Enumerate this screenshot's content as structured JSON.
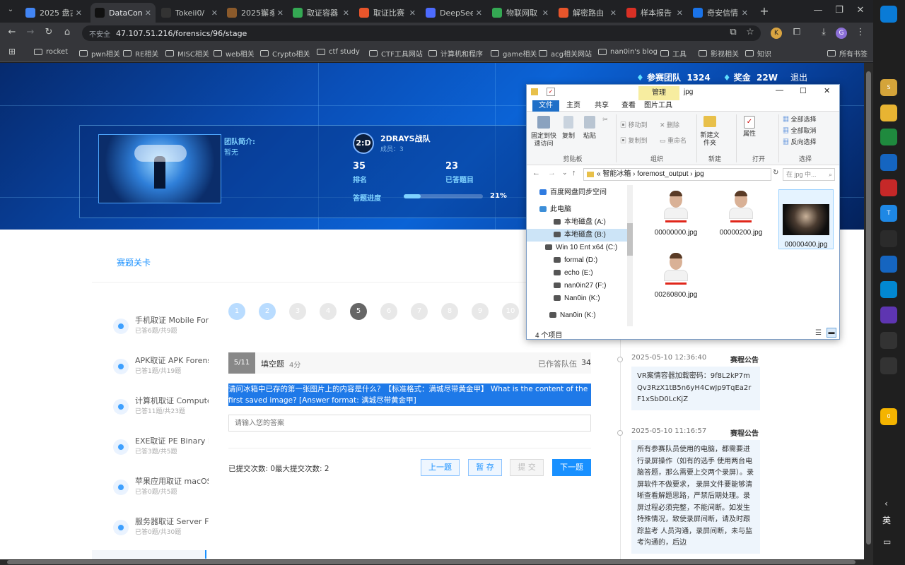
{
  "browser": {
    "tabs": [
      {
        "label": "2025 盘古",
        "color": "#4285f4",
        "active": false
      },
      {
        "label": "DataCon",
        "color": "#111111",
        "active": true
      },
      {
        "label": "Tokeii0/",
        "color": "#333333",
        "active": false
      },
      {
        "label": "2025獬豸",
        "color": "#8b5a2b",
        "active": false
      },
      {
        "label": "取证容器",
        "color": "#34a853",
        "active": false
      },
      {
        "label": "取证比赛",
        "color": "#e8552b",
        "active": false
      },
      {
        "label": "DeepSeek",
        "color": "#4d6bfe",
        "active": false
      },
      {
        "label": "物联网取",
        "color": "#34a853",
        "active": false
      },
      {
        "label": "解密路由",
        "color": "#e8552b",
        "active": false
      },
      {
        "label": "样本报告",
        "color": "#d93025",
        "active": false
      },
      {
        "label": "奇安信情",
        "color": "#1a73e8",
        "active": false
      }
    ],
    "new_tab": "+",
    "url_insecure": "不安全",
    "url": "47.107.51.216/forensics/96/stage",
    "avatar": "G",
    "bookmarks": [
      "rocket",
      "pwn相关",
      "RE相关",
      "MISC相关",
      "web相关",
      "Crypto相关",
      "ctf study",
      "CTF工具网站",
      "计算机和程序",
      "game相关",
      "acg相关网站",
      "nan0in's blog",
      "工具",
      "影视相关",
      "知识"
    ],
    "all_bookmarks": "所有书签"
  },
  "banner": {
    "teams_label": "参赛团队",
    "teams_count": "1324",
    "prize_label": "奖金",
    "prize_value": "22W",
    "logout": "退出",
    "team_intro_label": "团队简介:",
    "team_intro_value": "暂无",
    "team_logo": "2:D",
    "team_name": "2DRAYS战队",
    "members": "成员：3",
    "rank_value": "35",
    "rank_label": "排名",
    "answered_value": "23",
    "answered_label": "已答题目",
    "progress_label": "答题进度",
    "progress_pct": "21%",
    "progress_value": 0.21
  },
  "sidebar": {
    "title": "赛题关卡",
    "categories": [
      {
        "name": "手机取证 Mobile Forensics",
        "sub": "已答6题/共9题"
      },
      {
        "name": "APK取证 APK Forensics",
        "sub": "已答1题/共19题"
      },
      {
        "name": "计算机取证 Computer Forensics",
        "sub": "已答11题/共23题"
      },
      {
        "name": "EXE取证 PE Binary Forensics",
        "sub": "已答3题/共5题"
      },
      {
        "name": "苹果应用取证 macOS",
        "sub": "已答0题/共5题"
      },
      {
        "name": "服务器取证 Server Forensics",
        "sub": "已答0题/共30题"
      }
    ]
  },
  "question": {
    "numbers": [
      "1",
      "2",
      "3",
      "4",
      "5",
      "6",
      "7",
      "8",
      "9",
      "10"
    ],
    "current": "5",
    "answered": [
      "1",
      "2"
    ],
    "index_badge": "5/11",
    "type": "填空题",
    "score": "4分",
    "answered_by": "已作答队伍",
    "answered_by_count": "34",
    "text": "请问冰箱中已存的第一张图片上的内容是什么？【标准格式：满城尽带黄金甲】 What is the content of the first saved image? [Answer format: 满城尽带黄金甲]",
    "placeholder": "请输入您的答案",
    "submit_info": "已提交次数: 0最大提交次数: 2",
    "btn_prev": "上一题",
    "btn_save": "暂 存",
    "btn_submit": "提 交",
    "btn_next": "下一题"
  },
  "announcements": [
    {
      "time": "2025-05-10 12:36:40",
      "label": "赛程公告",
      "body": "VR案情容器加载密码：9f8L2kP7mQv3RzX1tB5n6yH4CwJp9TqEa2rF1xSbD0LcKjZ"
    },
    {
      "time": "2025-05-10 11:16:57",
      "label": "赛程公告",
      "body": "所有参赛队员使用的电脑，都需要进行录屏操作（如有的选手 使用两台电脑答题，那么需要上交两个录屏）。录屏软件不做要求， 录屏文件要能够清晰查看解题思路，严禁后期处理。录屏过程必须完整，不能间断。如发生特殊情况，致使录屏间断，请及时跟踪监考 人员沟通，录屏间断，未与监考沟通的，后边"
    }
  ],
  "explorer": {
    "manage_tab": "管理",
    "title": "jpg",
    "tabs": [
      "文件",
      "主页",
      "共享",
      "查看",
      "图片工具"
    ],
    "ribbon": {
      "pin": "固定到快速访问",
      "copy": "复制",
      "paste": "粘贴",
      "clipboard": "剪贴板",
      "move_to": "移动到",
      "copy_to": "复制到",
      "delete": "删除",
      "rename": "重命名",
      "organize": "组织",
      "new_folder": "新建文件夹",
      "new": "新建",
      "properties": "属性",
      "open": "打开",
      "select_all": "全部选择",
      "select_none": "全部取消",
      "invert": "反向选择",
      "select": "选择"
    },
    "path": [
      "智能冰箱",
      "foremost_output",
      "jpg"
    ],
    "search_placeholder": "在 jpg 中...",
    "tree": [
      "百度网盘同步空间",
      "此电脑",
      "本地磁盘 (A:)",
      "本地磁盘 (B:)",
      "Win 10 Ent x64 (C:)",
      "formal (D:)",
      "echo (E:)",
      "nan0in27 (F:)",
      "Nan0in (K:)",
      "Nan0in (K:)"
    ],
    "files": [
      "00000000.jpg",
      "00000200.jpg",
      "00000400.jpg",
      "00260800.jpg"
    ],
    "status": "4 个项目"
  },
  "taskbar": {
    "items": [
      "",
      "S",
      "",
      "",
      "",
      "",
      "T",
      "",
      "",
      "",
      "",
      "",
      "",
      "0"
    ],
    "ime": "英"
  }
}
